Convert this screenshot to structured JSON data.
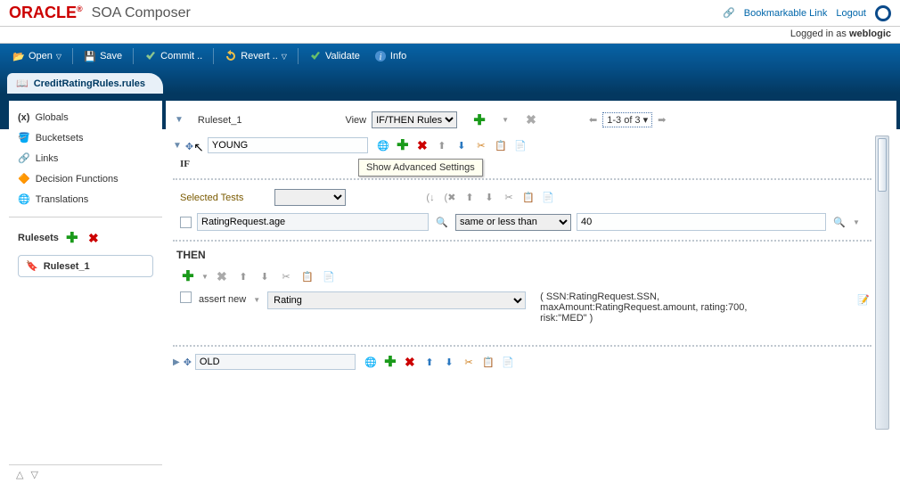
{
  "header": {
    "brand": "ORACLE",
    "app": "SOA Composer",
    "bookmark": "Bookmarkable Link",
    "logout": "Logout"
  },
  "login": {
    "prefix": "Logged in as ",
    "user": "weblogic"
  },
  "toolbar": {
    "open": "Open",
    "save": "Save",
    "commit": "Commit ..",
    "revert": "Revert ..",
    "validate": "Validate",
    "info": "Info"
  },
  "tab": {
    "label": "CreditRatingRules.rules"
  },
  "sidebar": {
    "items": [
      {
        "label": "Globals"
      },
      {
        "label": "Bucketsets"
      },
      {
        "label": "Links"
      },
      {
        "label": "Decision Functions"
      },
      {
        "label": "Translations"
      }
    ],
    "rulesets_title": "Rulesets",
    "ruleset_item": "Ruleset_1"
  },
  "ruleset_bar": {
    "name": "Ruleset_1",
    "view_label": "View",
    "view_value": "IF/THEN Rules",
    "pager": "1-3 of 3"
  },
  "rules": {
    "tooltip": "Show Advanced Settings",
    "young": {
      "name": "YOUNG",
      "if_label": "IF",
      "selected_tests": "Selected Tests",
      "test_lhs": "RatingRequest.age",
      "op": "same or less than",
      "test_rhs": "40",
      "then_label": "THEN",
      "assert_label": "assert new",
      "assert_target": "Rating",
      "params": "( SSN:RatingRequest.SSN, maxAmount:RatingRequest.amount, rating:700, risk:\"MED\" )"
    },
    "old": {
      "name": "OLD"
    }
  }
}
